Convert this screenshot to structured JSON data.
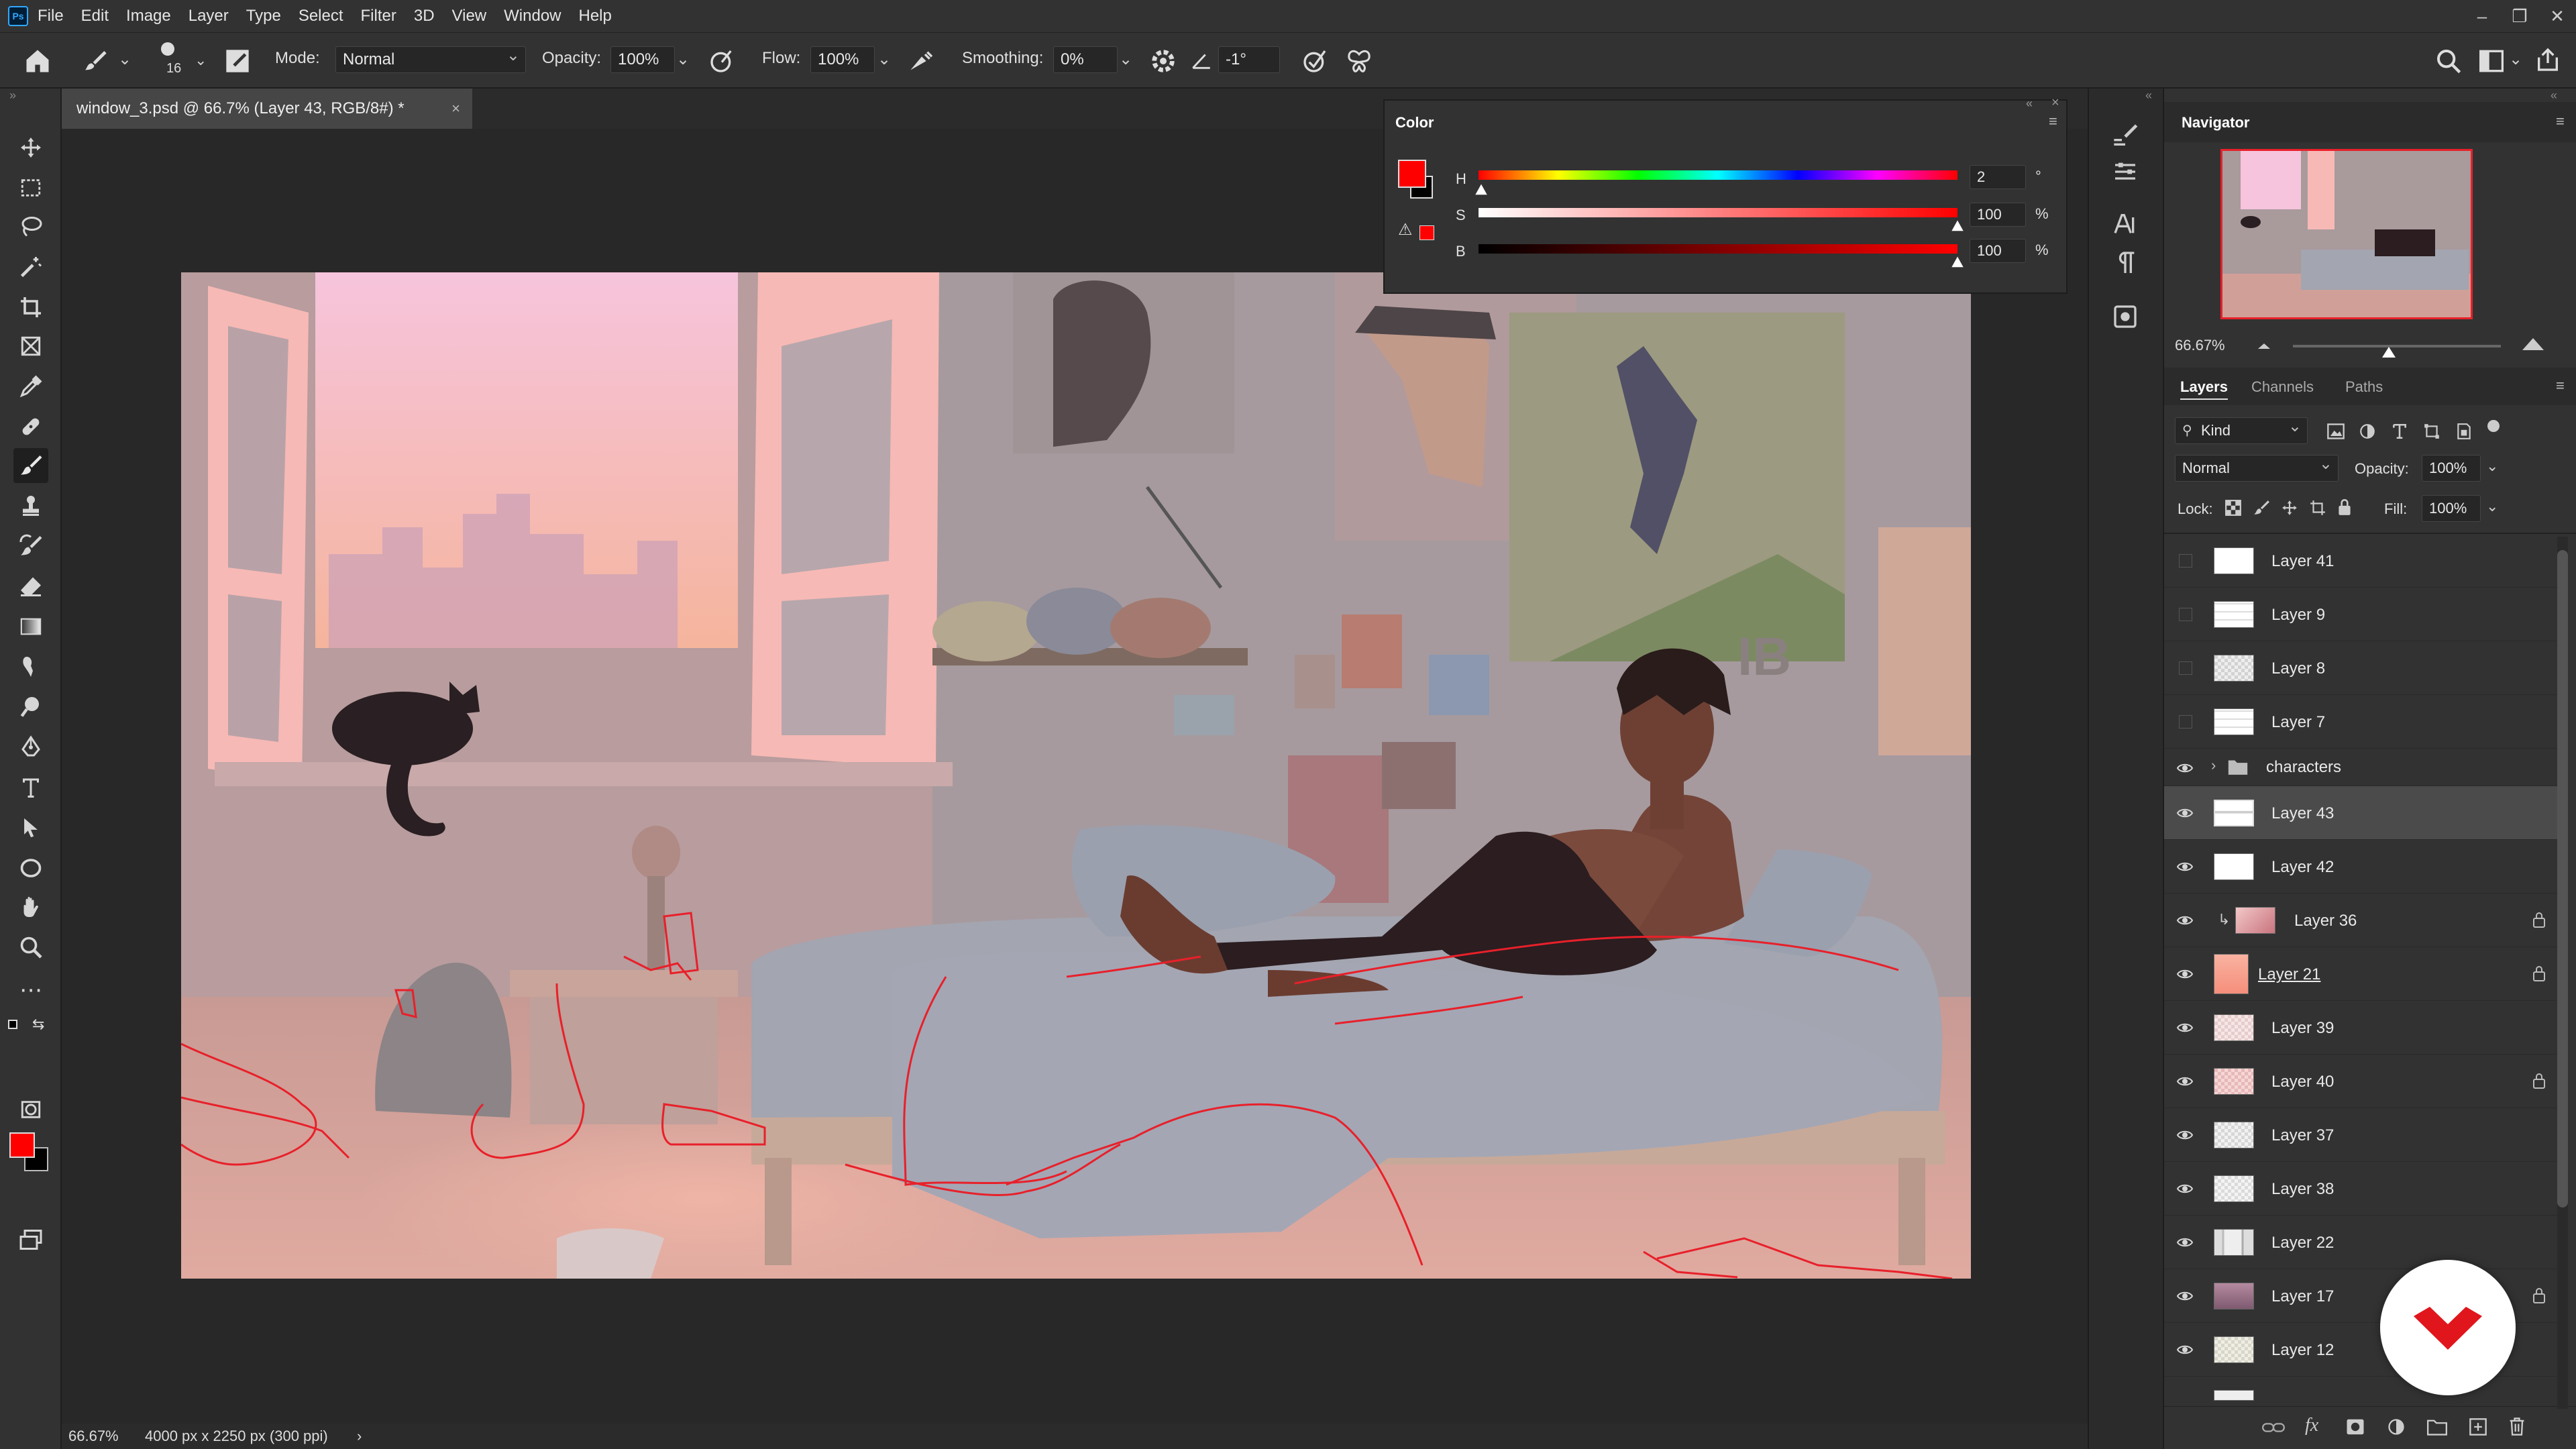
{
  "menu": {
    "items": [
      "File",
      "Edit",
      "Image",
      "Layer",
      "Type",
      "Select",
      "Filter",
      "3D",
      "View",
      "Window",
      "Help"
    ]
  },
  "options": {
    "brush_size": "16",
    "mode_label": "Mode:",
    "mode_value": "Normal",
    "opacity_label": "Opacity:",
    "opacity_value": "100%",
    "flow_label": "Flow:",
    "flow_value": "100%",
    "smoothing_label": "Smoothing:",
    "smoothing_value": "0%",
    "angle_value": "-1°"
  },
  "document": {
    "tab_title": "window_3.psd @ 66.7% (Layer 43, RGB/8#) *",
    "zoom": "66.67%",
    "size_info": "4000 px x 2250 px (300 ppi)"
  },
  "color_panel": {
    "title": "Color",
    "foreground": "#ff0000",
    "background": "#000000",
    "h": {
      "label": "H",
      "value": "2",
      "unit": "°",
      "fraction": 0.006
    },
    "s": {
      "label": "S",
      "value": "100",
      "unit": "%",
      "fraction": 1.0
    },
    "b": {
      "label": "B",
      "value": "100",
      "unit": "%",
      "fraction": 1.0
    }
  },
  "navigator": {
    "title": "Navigator",
    "zoom": "66.67%",
    "zoom_fraction": 0.46
  },
  "layers_panel": {
    "tabs": [
      "Layers",
      "Channels",
      "Paths"
    ],
    "filter_kind": "Kind",
    "blend_mode": "Normal",
    "opacity_label": "Opacity:",
    "opacity_value": "100%",
    "lock_label": "Lock:",
    "fill_label": "Fill:",
    "fill_value": "100%",
    "layers": [
      {
        "name": "Layer 41",
        "visible": false,
        "locked": false,
        "selected": false,
        "thumb": "#ffffff"
      },
      {
        "name": "Layer 9",
        "visible": false,
        "locked": false,
        "selected": false,
        "thumb": "#ffffff"
      },
      {
        "name": "Layer 8",
        "visible": false,
        "locked": false,
        "selected": false,
        "thumb": "#e6e6e6"
      },
      {
        "name": "Layer 7",
        "visible": false,
        "locked": false,
        "selected": false,
        "thumb": "#ffffff"
      },
      {
        "name": "characters",
        "visible": true,
        "locked": false,
        "selected": false,
        "group": true
      },
      {
        "name": "Layer 43",
        "visible": true,
        "locked": false,
        "selected": true,
        "thumb": "#f2f2f2"
      },
      {
        "name": "Layer 42",
        "visible": true,
        "locked": false,
        "selected": false,
        "thumb": "#ffffff"
      },
      {
        "name": "Layer 36",
        "visible": true,
        "locked": true,
        "selected": false,
        "clipped": true,
        "thumb": "#d9868f"
      },
      {
        "name": "Layer 21",
        "visible": true,
        "locked": true,
        "selected": false,
        "thumb": "#f5a37f"
      },
      {
        "name": "Layer 39",
        "visible": true,
        "locked": false,
        "selected": false,
        "thumb": "#f2dede"
      },
      {
        "name": "Layer 40",
        "visible": true,
        "locked": true,
        "selected": false,
        "thumb": "#f2c8c8"
      },
      {
        "name": "Layer 37",
        "visible": true,
        "locked": false,
        "selected": false,
        "thumb": "#e8e8e8"
      },
      {
        "name": "Layer 38",
        "visible": true,
        "locked": false,
        "selected": false,
        "thumb": "#ececec"
      },
      {
        "name": "Layer 22",
        "visible": true,
        "locked": false,
        "selected": false,
        "thumb": "#d9d9e6"
      },
      {
        "name": "Layer 17",
        "visible": true,
        "locked": true,
        "selected": false,
        "thumb": "#9a6f88"
      },
      {
        "name": "Layer 12",
        "visible": true,
        "locked": false,
        "selected": false,
        "thumb": "#e8e8e0"
      }
    ]
  }
}
